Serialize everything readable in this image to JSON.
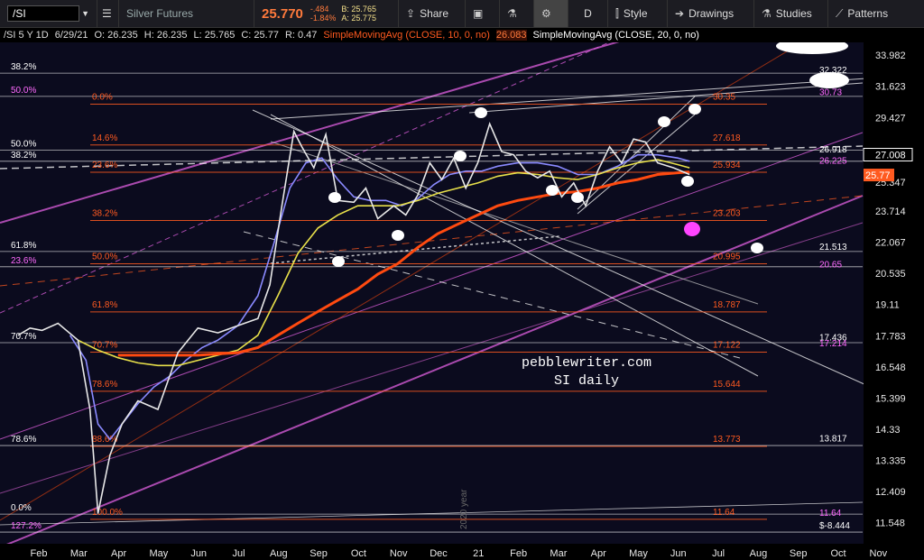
{
  "toolbar": {
    "symbol": "/SI",
    "description": "Silver Futures",
    "last": "25.770",
    "change": "-.484",
    "change_pct": "-1.84%",
    "bid": "B: 25.765",
    "ask": "A: 25.775",
    "share": "Share",
    "aggregation": "D",
    "style": "Style",
    "drawings": "Drawings",
    "studies": "Studies",
    "patterns": "Patterns"
  },
  "infobar": {
    "symbol": "/SI 5 Y 1D",
    "date": "6/29/21",
    "open": "O: 26.235",
    "high": "H: 26.235",
    "low": "L: 25.765",
    "close": "C: 25.77",
    "range": "R: 0.47",
    "sma10_label": "SimpleMovingAvg (CLOSE, 10, 0, no)",
    "sma10_value": "26.083",
    "sma20_label": "SimpleMovingAvg (CLOSE, 20, 0, no)"
  },
  "chart_data": {
    "type": "line",
    "title": "",
    "watermark": [
      "pebblewriter.com",
      "SI daily"
    ],
    "year_label": "2020 year",
    "x_ticks": [
      "Feb",
      "Mar",
      "Apr",
      "May",
      "Jun",
      "Jul",
      "Aug",
      "Sep",
      "Oct",
      "Nov",
      "Dec",
      "21",
      "Feb",
      "Mar",
      "Apr",
      "May",
      "Jun",
      "Jul",
      "Aug",
      "Sep",
      "Oct",
      "Nov"
    ],
    "y_axis": {
      "min": 11.0,
      "max": 35.0,
      "scale": "log"
    },
    "y_ticks": [
      33.982,
      31.623,
      29.427,
      27.008,
      25.347,
      23.714,
      22.067,
      20.535,
      19.11,
      17.783,
      16.548,
      15.399,
      14.33,
      13.335,
      12.409,
      11.548
    ],
    "last_price": 25.77,
    "current_price_label": "27.008",
    "fib_levels_left": [
      {
        "label": "38.2%",
        "price": 32.6
      },
      {
        "label": "50.0%",
        "price": 30.9
      },
      {
        "label": "50.0%",
        "price": 27.3
      },
      {
        "label": "38.2%",
        "price": 26.6
      },
      {
        "label": "61.8%",
        "price": 21.6
      },
      {
        "label": "23.6%",
        "price": 20.85
      },
      {
        "label": "70.7%",
        "price": 17.5
      },
      {
        "label": "78.6%",
        "price": 13.8
      },
      {
        "label": "0.0%",
        "price": 11.78
      },
      {
        "label": "127.2%",
        "price": 11.3
      }
    ],
    "fib_levels_orange": [
      {
        "label": "0.0%",
        "value": "30.35",
        "price": 30.35
      },
      {
        "label": "14.6%",
        "value": "27.618",
        "price": 27.618
      },
      {
        "label": "23.6%",
        "value": "25.934",
        "price": 25.934
      },
      {
        "label": "38.2%",
        "value": "23.203",
        "price": 23.203
      },
      {
        "label": "50.0%",
        "value": "20.995",
        "price": 20.995
      },
      {
        "label": "61.8%",
        "value": "18.787",
        "price": 18.787
      },
      {
        "label": "70.7%",
        "value": "17.122",
        "price": 17.122
      },
      {
        "label": "78.6%",
        "value": "15.644",
        "price": 15.644
      },
      {
        "label": "88.6%",
        "value": "13.773",
        "price": 13.773
      },
      {
        "label": "100.0%",
        "value": "11.64",
        "price": 11.64
      }
    ],
    "right_labels": [
      {
        "text": "32.322",
        "price": 32.322,
        "color": "#ffffff"
      },
      {
        "text": "30.73",
        "price": 30.73,
        "color": "#ff6aff"
      },
      {
        "text": "26.918",
        "price": 26.918,
        "color": "#ffffff"
      },
      {
        "text": "26.225",
        "price": 26.225,
        "color": "#ff6aff"
      },
      {
        "text": "21.513",
        "price": 21.513,
        "color": "#ffffff"
      },
      {
        "text": "20.65",
        "price": 20.65,
        "color": "#ff6aff"
      },
      {
        "text": "17.436",
        "price": 17.436,
        "color": "#ffffff"
      },
      {
        "text": "17.214",
        "price": 17.214,
        "color": "#ff6aff"
      },
      {
        "text": "13.817",
        "price": 13.817,
        "color": "#ffffff"
      },
      {
        "text": "11.64",
        "price": 11.64,
        "color": "#ff6aff"
      },
      {
        "text": "$-8.444",
        "price": 11.3,
        "color": "#ffffff"
      }
    ],
    "series": [
      {
        "name": "price",
        "color": "#e8e8e8",
        "x": [
          0.0,
          0.3,
          0.6,
          1.0,
          1.5,
          1.8,
          2.0,
          2.3,
          2.6,
          3.0,
          3.5,
          4.0,
          4.5,
          5.0,
          5.5,
          6.0,
          6.3,
          6.6,
          6.9,
          7.1,
          7.4,
          7.7,
          8.0,
          8.4,
          8.7,
          9.0,
          9.4,
          9.7,
          10.0,
          10.3,
          10.6,
          10.9,
          11.2,
          11.5,
          11.8,
          12.1,
          12.4,
          12.7,
          13.0,
          13.3,
          13.6,
          13.9,
          14.2,
          14.5,
          14.8,
          15.1,
          15.4,
          15.7,
          16.0,
          16.4,
          16.8
        ],
        "values": [
          17.8,
          18.1,
          18.0,
          18.3,
          17.6,
          15.0,
          11.8,
          13.5,
          14.5,
          15.3,
          15.0,
          17.1,
          18.1,
          17.9,
          18.2,
          18.5,
          20.0,
          24.0,
          28.5,
          27.5,
          26.2,
          28.3,
          24.3,
          24.2,
          25.0,
          23.3,
          24.0,
          23.5,
          24.6,
          26.5,
          25.5,
          26.8,
          25.0,
          26.5,
          29.0,
          27.2,
          27.0,
          26.0,
          25.6,
          26.0,
          24.5,
          25.3,
          24.0,
          26.0,
          27.5,
          26.5,
          28.0,
          27.8,
          26.5,
          26.2,
          25.8
        ]
      },
      {
        "name": "",
        "color": "#ff4a10",
        "x": [
          2.5,
          3.5,
          4.5,
          5.5,
          6.0,
          6.5,
          7.0,
          7.5,
          8.0,
          8.5,
          9.0,
          9.5,
          10.0,
          10.5,
          11.0,
          11.5,
          12.0,
          12.5,
          13.0,
          13.5,
          14.0,
          14.5,
          15.0,
          15.5,
          16.0,
          16.5,
          16.8
        ],
        "values": [
          17.0,
          17.0,
          17.0,
          17.1,
          17.3,
          17.8,
          18.3,
          18.8,
          19.3,
          19.8,
          20.5,
          21.0,
          21.8,
          22.5,
          23.0,
          23.5,
          24.0,
          24.3,
          24.5,
          24.7,
          24.8,
          25.0,
          25.3,
          25.5,
          25.8,
          25.9,
          25.95
        ]
      },
      {
        "name": "",
        "color": "#e8e04a",
        "x": [
          1.5,
          2.0,
          2.5,
          3.0,
          3.5,
          4.0,
          4.5,
          5.0,
          5.5,
          6.0,
          6.5,
          7.0,
          7.5,
          8.0,
          8.5,
          9.0,
          9.5,
          10.0,
          10.5,
          11.0,
          11.5,
          12.0,
          12.5,
          13.0,
          13.5,
          14.0,
          14.5,
          15.0,
          15.5,
          16.0,
          16.5,
          16.8
        ],
        "values": [
          17.6,
          17.2,
          16.9,
          16.7,
          16.6,
          16.6,
          16.8,
          17.0,
          17.2,
          17.8,
          19.5,
          21.5,
          22.8,
          23.5,
          24.0,
          24.0,
          24.0,
          24.3,
          24.7,
          25.0,
          25.3,
          25.7,
          25.9,
          25.8,
          25.6,
          25.5,
          25.8,
          26.2,
          26.5,
          26.7,
          26.4,
          26.2
        ]
      },
      {
        "name": "",
        "color": "#8a8aff",
        "x": [
          1.3,
          1.7,
          2.0,
          2.3,
          2.6,
          3.0,
          3.4,
          3.8,
          4.2,
          4.6,
          5.0,
          5.5,
          6.0,
          6.4,
          6.8,
          7.2,
          7.6,
          8.0,
          8.4,
          8.8,
          9.2,
          9.6,
          10.0,
          10.4,
          10.8,
          11.2,
          11.6,
          12.0,
          12.5,
          13.0,
          13.5,
          14.0,
          14.5,
          15.0,
          15.5,
          16.0,
          16.5,
          16.8
        ],
        "values": [
          17.8,
          16.8,
          14.5,
          14.0,
          14.5,
          15.2,
          15.8,
          16.2,
          16.8,
          17.3,
          17.6,
          18.2,
          19.5,
          22.0,
          25.0,
          26.5,
          26.8,
          25.5,
          24.5,
          24.3,
          24.3,
          24.0,
          24.4,
          25.2,
          25.8,
          26.0,
          26.0,
          26.3,
          26.5,
          26.5,
          26.3,
          25.8,
          25.8,
          26.3,
          27.0,
          27.0,
          26.8,
          26.6
        ]
      }
    ]
  }
}
